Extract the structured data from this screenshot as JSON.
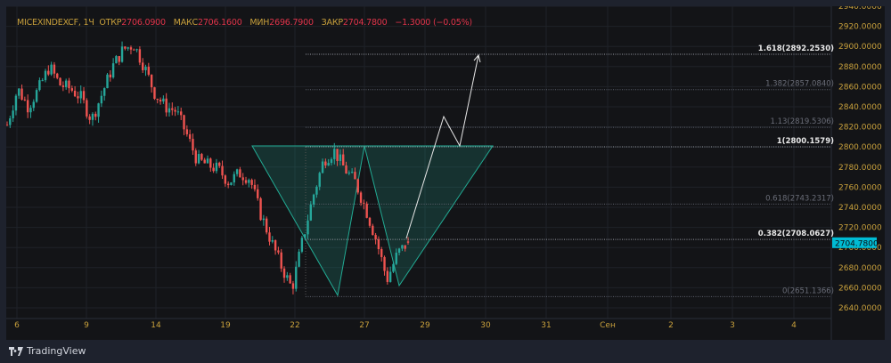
{
  "legend": {
    "symbol": "MICEXINDEXCF, 1Ч",
    "open_label": "ОТКР",
    "open": "2706.0900",
    "high_label": "МАКС",
    "high": "2706.1600",
    "low_label": "МИН",
    "low": "2696.7900",
    "close_label": "ЗАКР",
    "close": "2704.7800",
    "change": "−1.3000 (−0.05%)"
  },
  "footer": {
    "brand": "TradingView",
    "logo_icon": "tradingview-logo-icon"
  },
  "colors": {
    "up": "#26a69a",
    "down": "#ef5350",
    "pattern": "#22ab94",
    "price_tag": "#00bcd4",
    "axis_text": "#c8a03c"
  },
  "chart_data": {
    "type": "candlestick",
    "symbol": "MICEXINDEXCF",
    "interval": "1H",
    "ylim": [
      2640,
      2940
    ],
    "y_ticks": [
      "2940.0000",
      "2920.0000",
      "2900.0000",
      "2880.0000",
      "2860.0000",
      "2840.0000",
      "2820.0000",
      "2800.0000",
      "2780.0000",
      "2760.0000",
      "2740.0000",
      "2720.0000",
      "2700.0000",
      "2680.0000",
      "2660.0000",
      "2640.0000"
    ],
    "x_ticks": [
      "6",
      "9",
      "14",
      "19",
      "22",
      "27",
      "29",
      "30",
      "31",
      "Сен",
      "2",
      "3",
      "4"
    ],
    "grid": true,
    "last_price": "2704.7800",
    "approx_close_path": [
      2822,
      2858,
      2840,
      2858,
      2880,
      2862,
      2858,
      2849,
      2827,
      2853,
      2880,
      2897,
      2902,
      2880,
      2853,
      2840,
      2836,
      2813,
      2787,
      2782,
      2778,
      2765,
      2774,
      2769,
      2734,
      2707,
      2681,
      2659,
      2707,
      2751,
      2787,
      2796,
      2778,
      2765,
      2738,
      2707,
      2668,
      2694,
      2704.78
    ],
    "fibonacci": [
      {
        "label": "1.618(2892.2530)",
        "price": 2892.253,
        "bold": true
      },
      {
        "label": "1.382(2857.0840)",
        "price": 2857.084,
        "bold": false
      },
      {
        "label": "1.13(2819.5306)",
        "price": 2819.5306,
        "bold": false
      },
      {
        "label": "1(2800.1579)",
        "price": 2800.1579,
        "bold": true
      },
      {
        "label": "0.618(2743.2317)",
        "price": 2743.2317,
        "bold": false
      },
      {
        "label": "0.382(2708.0627)",
        "price": 2708.0627,
        "bold": true
      },
      {
        "label": "0(2651.1366)",
        "price": 2651.1366,
        "bold": false
      }
    ]
  }
}
